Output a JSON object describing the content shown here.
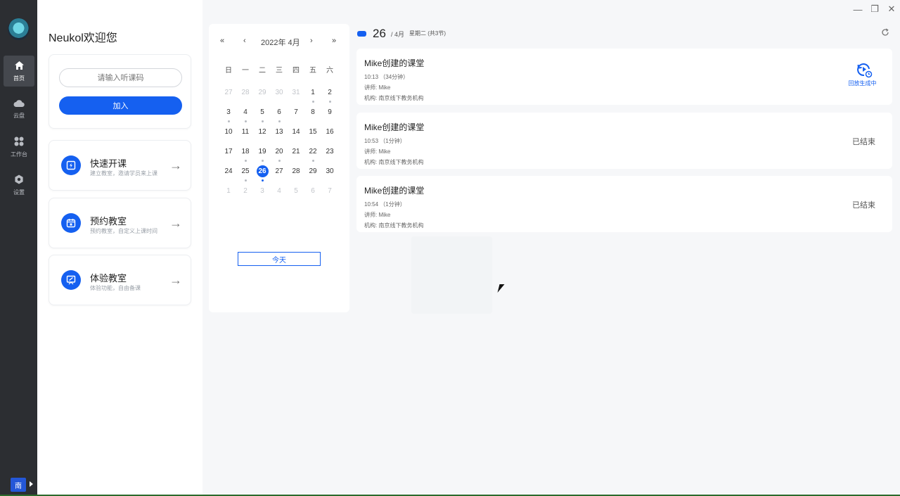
{
  "window": {
    "controls": {
      "minimize": "—",
      "restore": "❐",
      "close": "✕"
    }
  },
  "rail": {
    "items": [
      {
        "label": "首页",
        "icon": "home-icon",
        "active": true
      },
      {
        "label": "云盘",
        "icon": "cloud-icon",
        "active": false
      },
      {
        "label": "工作台",
        "icon": "apps-icon",
        "active": false
      },
      {
        "label": "设置",
        "icon": "settings-icon",
        "active": false
      }
    ],
    "org_badge": "南"
  },
  "left": {
    "welcome": "Neukol欢迎您",
    "join": {
      "placeholder": "请输入听课码",
      "button": "加入"
    },
    "actions": [
      {
        "title": "快速开课",
        "desc": "建立教室，邀请学员来上课",
        "icon": "lightning-icon"
      },
      {
        "title": "预约教室",
        "desc": "预约教室，自定义上课时间",
        "icon": "calendar-plus-icon"
      },
      {
        "title": "体验教室",
        "desc": "体验功能，自由备课",
        "icon": "presentation-icon"
      }
    ],
    "arrow": "→"
  },
  "calendar": {
    "month_label": "2022年 4月",
    "nav": {
      "prev_year": "«",
      "prev_month": "‹",
      "next_month": "›",
      "next_year": "»"
    },
    "weekdays": [
      "日",
      "一",
      "二",
      "三",
      "四",
      "五",
      "六"
    ],
    "days": [
      {
        "d": "27",
        "muted": true
      },
      {
        "d": "28",
        "muted": true
      },
      {
        "d": "29",
        "muted": true
      },
      {
        "d": "30",
        "muted": true
      },
      {
        "d": "31",
        "muted": true
      },
      {
        "d": "1",
        "dot": true
      },
      {
        "d": "2",
        "dot": true
      },
      {
        "d": "3",
        "dot": true
      },
      {
        "d": "4",
        "dot": true
      },
      {
        "d": "5",
        "dot": true
      },
      {
        "d": "6",
        "dot": true
      },
      {
        "d": "7"
      },
      {
        "d": "8"
      },
      {
        "d": "9"
      },
      {
        "d": "10"
      },
      {
        "d": "11"
      },
      {
        "d": "12"
      },
      {
        "d": "13"
      },
      {
        "d": "14"
      },
      {
        "d": "15"
      },
      {
        "d": "16"
      },
      {
        "d": "17"
      },
      {
        "d": "18",
        "dot": true
      },
      {
        "d": "19",
        "dot": true
      },
      {
        "d": "20",
        "dot": true
      },
      {
        "d": "21"
      },
      {
        "d": "22",
        "dot": true
      },
      {
        "d": "23"
      },
      {
        "d": "24"
      },
      {
        "d": "25",
        "dot": true
      },
      {
        "d": "26",
        "selected": true,
        "dot": true
      },
      {
        "d": "27"
      },
      {
        "d": "28"
      },
      {
        "d": "29"
      },
      {
        "d": "30"
      },
      {
        "d": "1",
        "muted": true
      },
      {
        "d": "2",
        "muted": true
      },
      {
        "d": "3",
        "muted": true
      },
      {
        "d": "4",
        "muted": true
      },
      {
        "d": "5",
        "muted": true
      },
      {
        "d": "6",
        "muted": true
      },
      {
        "d": "7",
        "muted": true
      }
    ],
    "today_button": "今天"
  },
  "schedule": {
    "day": "26",
    "month": "/ 4月",
    "weekday": "星期二 (共3节)",
    "refresh_icon": "refresh-icon",
    "lessons": [
      {
        "title": "Mike创建的课堂",
        "time": "10:13  （34分钟）",
        "teacher": "讲师: Mike",
        "org": "机构: 南京线下教务机构",
        "status": "回放生成中",
        "status_type": "replay"
      },
      {
        "title": "Mike创建的课堂",
        "time": "10:53  （1分钟）",
        "teacher": "讲师: Mike",
        "org": "机构: 南京线下教务机构",
        "status": "已结束",
        "status_type": "ended"
      },
      {
        "title": "Mike创建的课堂",
        "time": "10:54  （1分钟）",
        "teacher": "讲师: Mike",
        "org": "机构: 南京线下教务机构",
        "status": "已结束",
        "status_type": "ended"
      }
    ]
  },
  "colors": {
    "accent": "#1560f0",
    "rail": "#2c2e32"
  }
}
